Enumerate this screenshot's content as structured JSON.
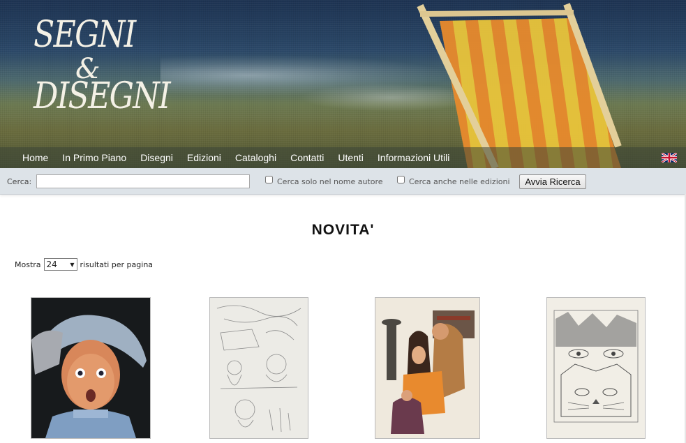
{
  "banner": {
    "logo": "SEGNI & DISEGNI"
  },
  "nav": {
    "items": [
      {
        "label": "Home"
      },
      {
        "label": "In Primo Piano"
      },
      {
        "label": "Disegni"
      },
      {
        "label": "Edizioni"
      },
      {
        "label": "Cataloghi"
      },
      {
        "label": "Contatti"
      },
      {
        "label": "Utenti"
      },
      {
        "label": "Informazioni Utili"
      }
    ],
    "language_icon": "uk-flag-icon"
  },
  "search": {
    "label": "Cerca:",
    "value": "",
    "option_author_only": "Cerca solo nel nome autore",
    "option_editions": "Cerca anche nelle edizioni",
    "button": "Avvia Ricerca"
  },
  "main": {
    "title": "NOVITA'",
    "show_prefix": "Mostra",
    "per_page": "24",
    "show_suffix": "risultati per pagina"
  },
  "colors": {
    "nav_text": "#ffffff",
    "search_bar": "#dde3e8",
    "title": "#111111"
  }
}
